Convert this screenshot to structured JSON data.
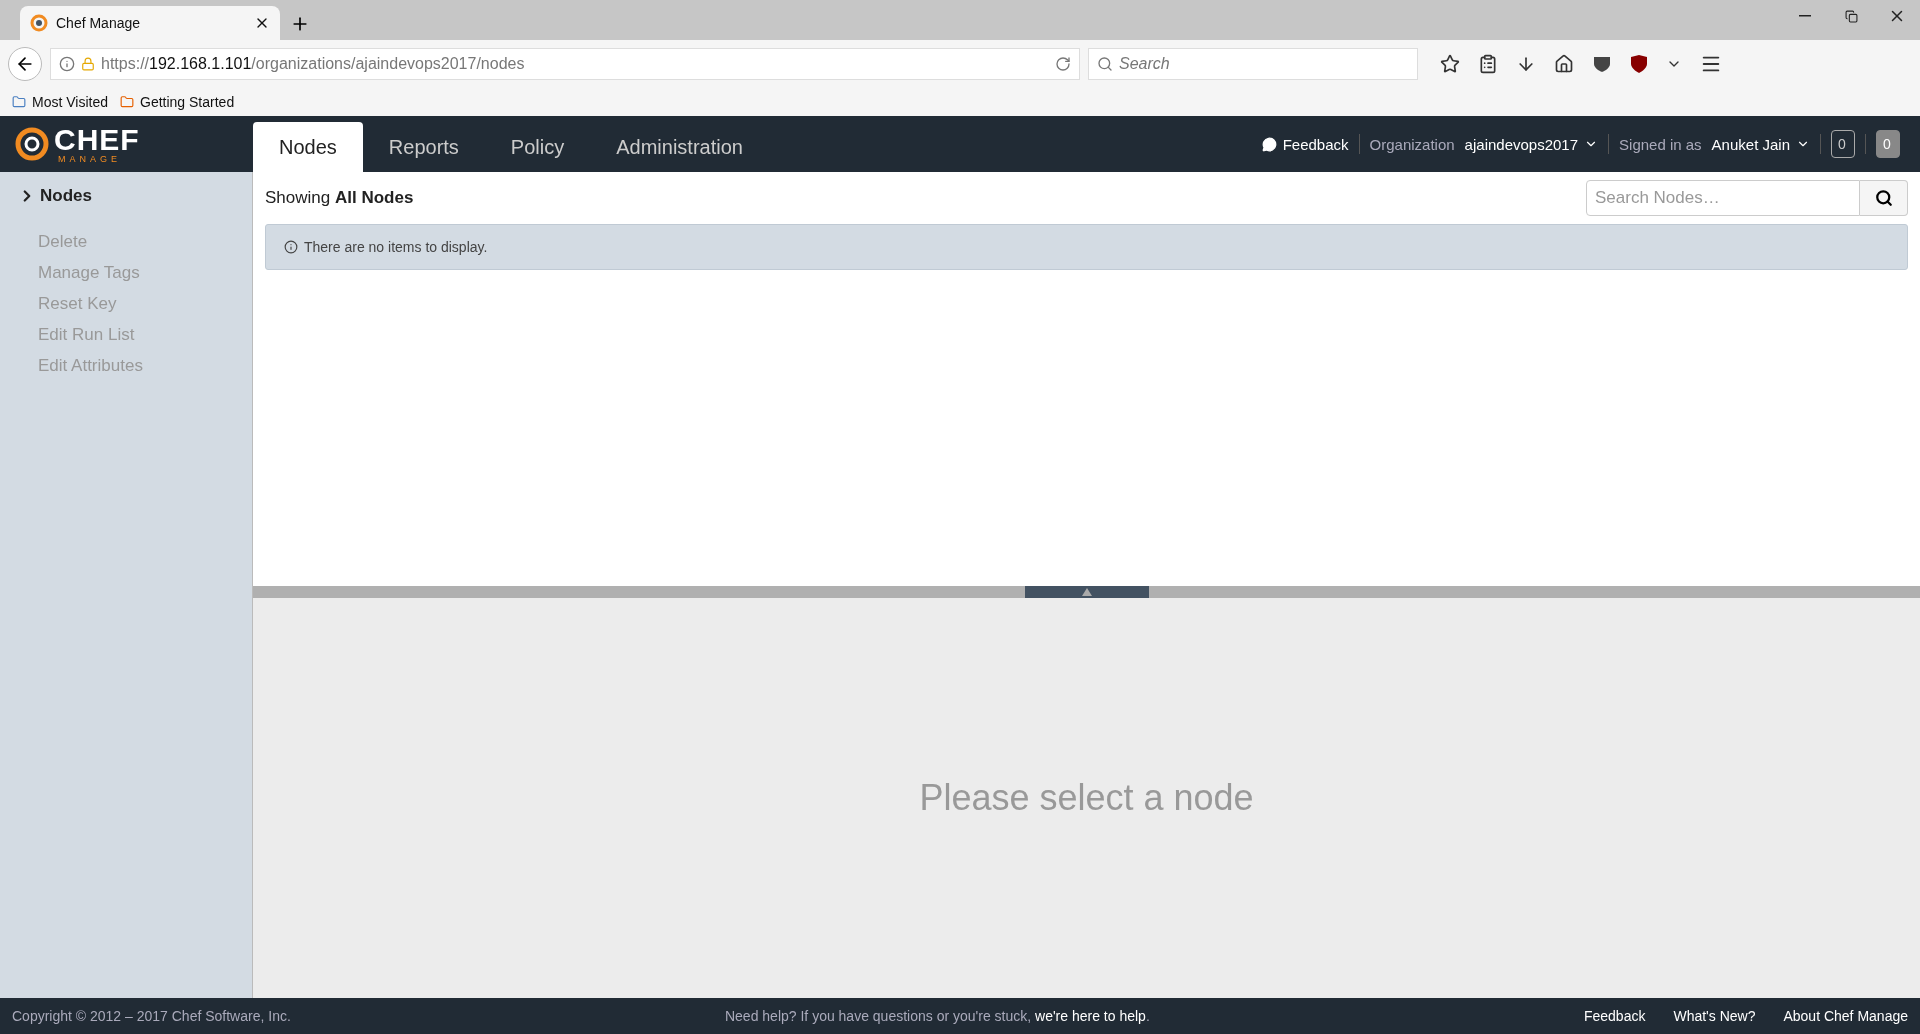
{
  "browser": {
    "tab_title": "Chef Manage",
    "url_scheme": "https://",
    "url_host": "192.168.1.101",
    "url_path": "/organizations/ajaindevops2017/nodes",
    "search_placeholder": "Search",
    "bookmarks": [
      "Most Visited",
      "Getting Started"
    ]
  },
  "header": {
    "logo_word": "CHEF",
    "logo_sub": "MANAGE",
    "tabs": [
      {
        "label": "Nodes",
        "selected": true
      },
      {
        "label": "Reports",
        "selected": false
      },
      {
        "label": "Policy",
        "selected": false
      },
      {
        "label": "Administration",
        "selected": false
      }
    ],
    "feedback": "Feedback",
    "org_label": "Organization",
    "org_name": "ajaindevops2017",
    "signed_label": "Signed in as",
    "user_name": "Anuket Jain",
    "counters": [
      {
        "value": "0",
        "kind": "outline"
      },
      {
        "value": "0",
        "kind": "filled"
      }
    ]
  },
  "sidebar": {
    "title": "Nodes",
    "actions": [
      {
        "label": "Delete",
        "disabled": true
      },
      {
        "label": "Manage Tags",
        "disabled": true
      },
      {
        "label": "Reset Key",
        "disabled": true
      },
      {
        "label": "Edit Run List",
        "disabled": true
      },
      {
        "label": "Edit Attributes",
        "disabled": true
      }
    ]
  },
  "list": {
    "showing": "Showing **All Nodes**",
    "search_placeholder": "Search Nodes…",
    "empty_message": "There are no items to display."
  },
  "detail": {
    "message": "Please select a node"
  },
  "footer": {
    "copyright": "Copyright © 2012 – 2017 Chef Software, Inc.",
    "help_text": "Need help? If you have questions or you're stuck,",
    "help_link": "we're here to help",
    "help_end": ".",
    "links": [
      "Feedback",
      "What's New?",
      "About Chef Manage"
    ]
  }
}
